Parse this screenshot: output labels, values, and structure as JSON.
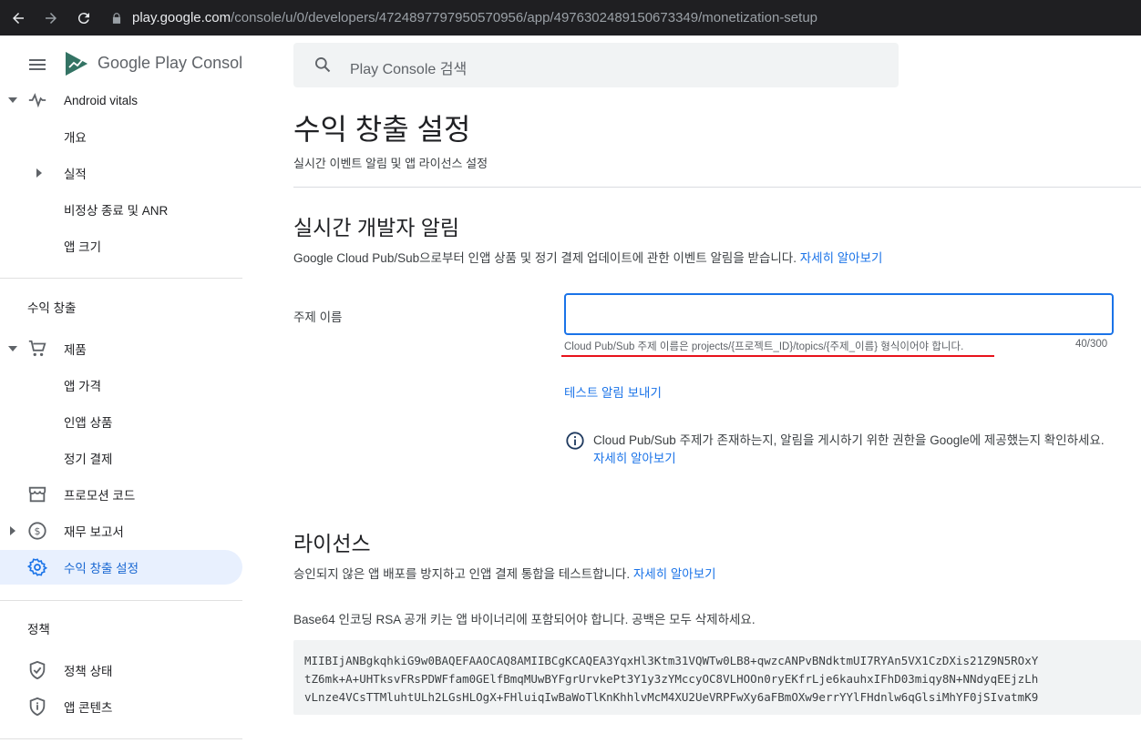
{
  "browser": {
    "url_host": "play.google.com",
    "url_path": "/console/u/0/developers/4724897797950570956/app/4976302489150673349/monetization-setup"
  },
  "brand": {
    "google_play": "Google Play",
    "console": "Console"
  },
  "sidebar": {
    "android_vitals": "Android vitals",
    "vitals_items": [
      "개요",
      "실적",
      "비정상 종료 및 ANR",
      "앱 크기"
    ],
    "monetization_section": "수익 창출",
    "products": "제품",
    "product_items": [
      "앱 가격",
      "인앱 상품",
      "정기 결제"
    ],
    "promo_codes": "프로모션 코드",
    "financial_reports": "재무 보고서",
    "monetization_setup": "수익 창출 설정",
    "policy_section": "정책",
    "policy_status": "정책 상태",
    "app_content": "앱 콘텐츠"
  },
  "search": {
    "placeholder": "Play Console 검색"
  },
  "page": {
    "title": "수익 창출 설정",
    "subtitle": "실시간 이벤트 알림 및 앱 라이선스 설정"
  },
  "rtdn": {
    "title": "실시간 개발자 알림",
    "description": "Google Cloud Pub/Sub으로부터 인앱 상품 및 정기 결제 업데이트에 관한 이벤트 알림을 받습니다.",
    "learn_more": "자세히 알아보기",
    "topic_label": "주제 이름",
    "topic_value": "",
    "hint": "Cloud Pub/Sub 주제 이름은 projects/{프로젝트_ID}/topics/{주제_이름} 형식이어야 합니다.",
    "counter": "40/300",
    "send_test": "테스트 알림 보내기",
    "info_line1": "Cloud Pub/Sub 주제가 존재하는지, 알림을 게시하기 위한 권한을 Google에 제공했는지 확인하세요.",
    "info_learn_more": "자세히 알아보기"
  },
  "licensing": {
    "title": "라이선스",
    "description": "승인되지 않은 앱 배포를 방지하고 인앱 결제 통합을 테스트합니다.",
    "learn_more": "자세히 알아보기",
    "key_label": "Base64 인코딩 RSA 공개 키는 앱 바이너리에 포함되어야 합니다. 공백은 모두 삭제하세요.",
    "key_lines": [
      "MIIBIjANBgkqhkiG9w0BAQEFAAOCAQ8AMIIBCgKCAQEA3YqxHl3Ktm31VQWTw0LB8+qwzcANPvBNdktmUI7RYAn5VX1CzDXis21Z9N5ROxY",
      "tZ6mk+A+UHTksvFRsPDWFfam0GElfBmqMUwBYFgrUrvkePt3Y1y3zYMccyOC8VLHOOn0ryEKfrLje6kauhxIFhD03miqy8N+NNdyqEEjzLh",
      "vLnze4VCsTTMluhtULh2LGsHLOgX+FHluiqIwBaWoTlKnKhhlvMcM4XU2UeVRPFwXy6aFBmOXw9errYYlFHdnlw6qGlsiMhYF0jSIvatmK9"
    ]
  }
}
